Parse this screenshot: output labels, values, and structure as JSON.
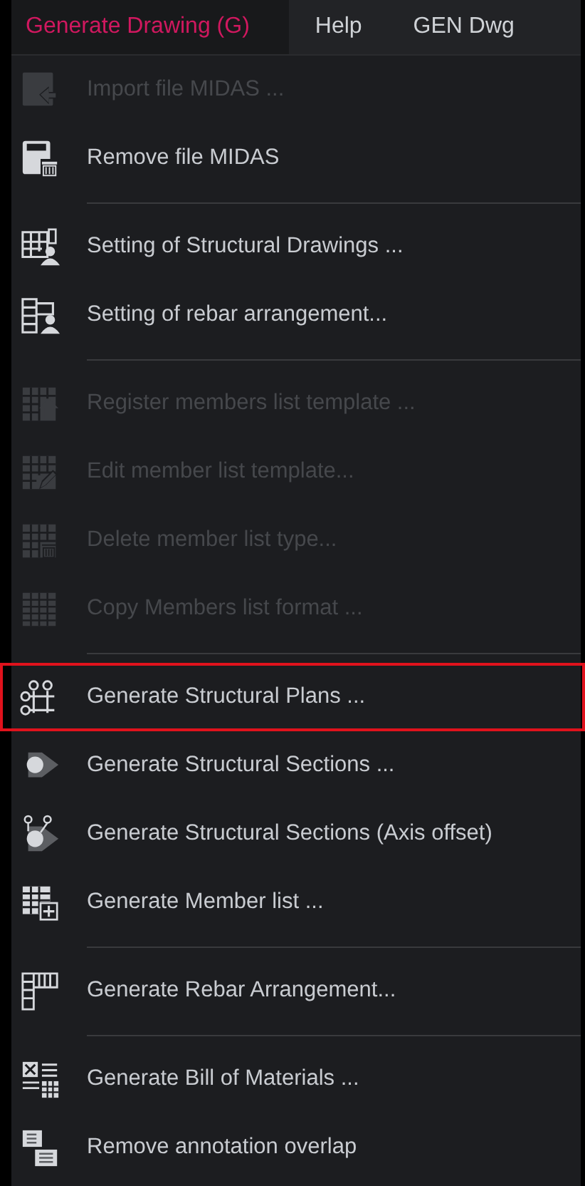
{
  "menu_bar": [
    {
      "label": "Generate Drawing (G)",
      "selected": true
    },
    {
      "label": "Help",
      "selected": false
    },
    {
      "label": "GEN Dwg",
      "selected": false
    }
  ],
  "items": [
    {
      "kind": "item",
      "label": "Import file MIDAS ...",
      "disabled": true,
      "highlighted": false
    },
    {
      "kind": "item",
      "label": "Remove file MIDAS",
      "disabled": false,
      "highlighted": false
    },
    {
      "kind": "separator"
    },
    {
      "kind": "item",
      "label": "Setting of Structural Drawings ...",
      "disabled": false,
      "highlighted": false
    },
    {
      "kind": "item",
      "label": "Setting of rebar arrangement...",
      "disabled": false,
      "highlighted": false
    },
    {
      "kind": "separator"
    },
    {
      "kind": "item",
      "label": "Register members list template ...",
      "disabled": true,
      "highlighted": false
    },
    {
      "kind": "item",
      "label": "Edit member list template...",
      "disabled": true,
      "highlighted": false
    },
    {
      "kind": "item",
      "label": "Delete member list type...",
      "disabled": true,
      "highlighted": false
    },
    {
      "kind": "item",
      "label": "Copy Members list format ...",
      "disabled": true,
      "highlighted": false
    },
    {
      "kind": "separator"
    },
    {
      "kind": "item",
      "label": "Generate Structural Plans ...",
      "disabled": false,
      "highlighted": true
    },
    {
      "kind": "item",
      "label": "Generate Structural Sections ...",
      "disabled": false,
      "highlighted": false
    },
    {
      "kind": "item",
      "label": "Generate Structural Sections (Axis offset)",
      "disabled": false,
      "highlighted": false
    },
    {
      "kind": "item",
      "label": "Generate Member list ...",
      "disabled": false,
      "highlighted": false
    },
    {
      "kind": "separator"
    },
    {
      "kind": "item",
      "label": "Generate Rebar Arrangement...",
      "disabled": false,
      "highlighted": false
    },
    {
      "kind": "separator"
    },
    {
      "kind": "item",
      "label": "Generate Bill of Materials ...",
      "disabled": false,
      "highlighted": false
    },
    {
      "kind": "item",
      "label": "Remove annotation overlap",
      "disabled": false,
      "highlighted": false
    }
  ]
}
